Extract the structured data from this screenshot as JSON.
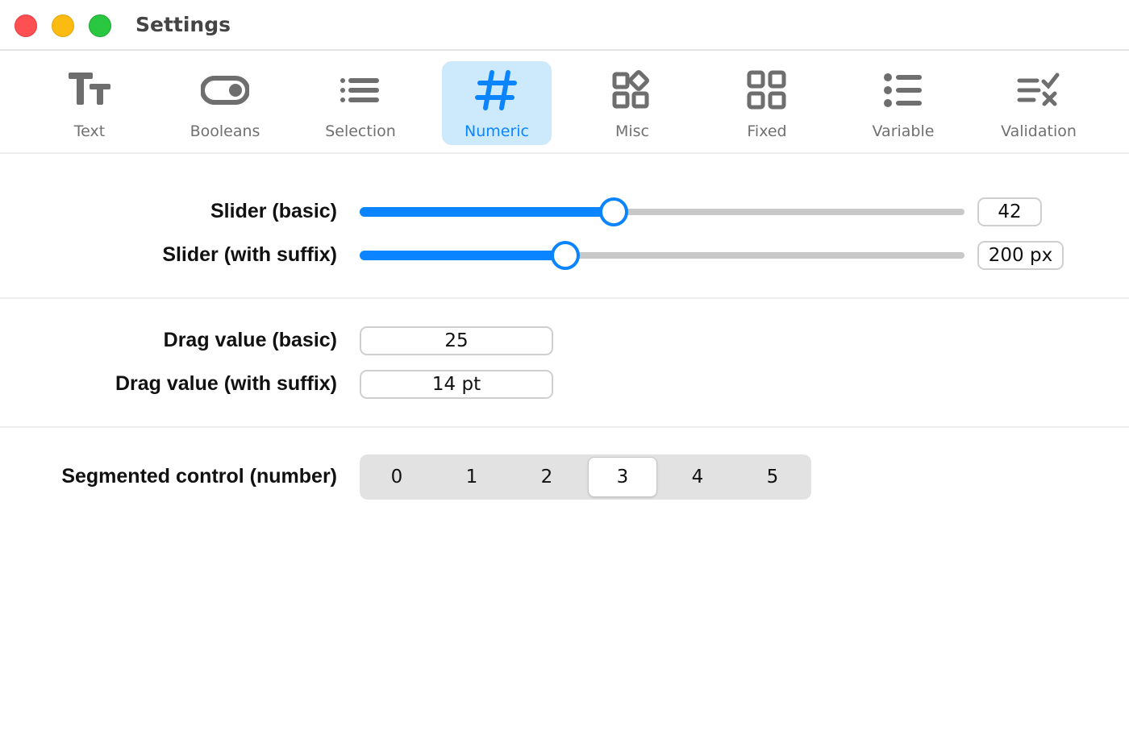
{
  "window": {
    "title": "Settings"
  },
  "toolbar": {
    "tabs": [
      {
        "label": "Text",
        "icon": "text-size-icon",
        "active": false
      },
      {
        "label": "Booleans",
        "icon": "toggle-icon",
        "active": false
      },
      {
        "label": "Selection",
        "icon": "list-icon",
        "active": false
      },
      {
        "label": "Numeric",
        "icon": "hash-icon",
        "active": true
      },
      {
        "label": "Misc",
        "icon": "shapes-icon",
        "active": false
      },
      {
        "label": "Fixed",
        "icon": "grid-icon",
        "active": false
      },
      {
        "label": "Variable",
        "icon": "bullet-list-icon",
        "active": false
      },
      {
        "label": "Validation",
        "icon": "checklist-icon",
        "active": false
      }
    ],
    "accent_color": "#0a84ff",
    "active_bg": "#cdeafd"
  },
  "sliders": [
    {
      "label": "Slider (basic)",
      "value": 42,
      "display": "42",
      "level": 0.42
    },
    {
      "label": "Slider (with suffix)",
      "value": 200,
      "display": "200 px",
      "level": 0.34
    }
  ],
  "drag_values": [
    {
      "label": "Drag value (basic)",
      "display": "25"
    },
    {
      "label": "Drag value (with suffix)",
      "display": "14 pt"
    }
  ],
  "segmented": {
    "label": "Segmented control (number)",
    "options": [
      "0",
      "1",
      "2",
      "3",
      "4",
      "5"
    ],
    "selected": "3"
  }
}
